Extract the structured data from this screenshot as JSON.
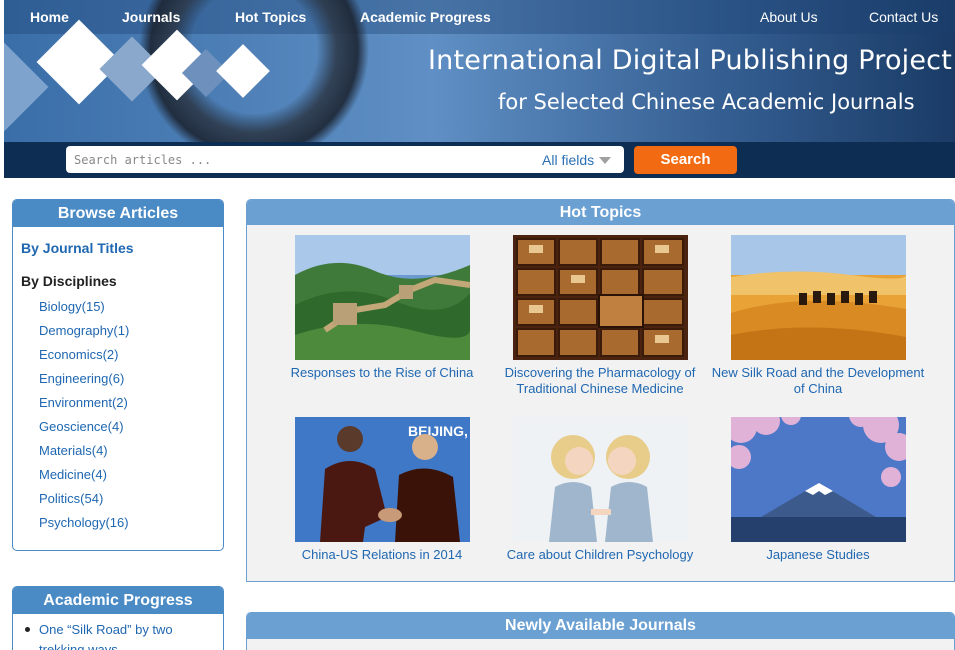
{
  "nav": {
    "home": "Home",
    "journals": "Journals",
    "hot_topics": "Hot Topics",
    "academic_progress": "Academic Progress",
    "about": "About Us",
    "contact": "Contact Us"
  },
  "banner": {
    "title_line1": "International Digital Publishing Project",
    "title_line2": "for Selected Chinese Academic Journals"
  },
  "search": {
    "placeholder": "Search articles ...",
    "field_selected": "All fields",
    "button": "Search"
  },
  "browse": {
    "title": "Browse Articles",
    "by_journal": "By Journal Titles",
    "by_disciplines": "By Disciplines",
    "disciplines": [
      "Biology(15)",
      "Demography(1)",
      "Economics(2)",
      "Engineering(6)",
      "Environment(2)",
      "Geoscience(4)",
      "Materials(4)",
      "Medicine(4)",
      "Politics(54)",
      "Psychology(16)"
    ]
  },
  "progress": {
    "title": "Academic Progress",
    "items": [
      "One “Silk Road” by two trekking ways"
    ]
  },
  "hot_topics": {
    "title": "Hot Topics",
    "items": [
      {
        "caption": "Responses to the Rise of China",
        "icon": "great-wall-photo"
      },
      {
        "caption": "Discovering the Pharmacology of Traditional Chinese Medicine",
        "icon": "herb-drawers-photo"
      },
      {
        "caption": "New Silk Road and the Development of China",
        "icon": "desert-caravan-photo"
      },
      {
        "caption": "China-US Relations in 2014",
        "icon": "handshake-photo",
        "photo_text": "BEIJING,"
      },
      {
        "caption": "Care about Children Psychology",
        "icon": "twin-girls-photo"
      },
      {
        "caption": "Japanese Studies",
        "icon": "mount-fuji-photo"
      }
    ]
  },
  "new_journals": {
    "title": "Newly Available Journals"
  },
  "colors": {
    "banner_dark": "#0d2e52",
    "panel_blue": "#4a8bc6",
    "link_blue": "#1f67b1",
    "search_orange": "#f26a12"
  }
}
